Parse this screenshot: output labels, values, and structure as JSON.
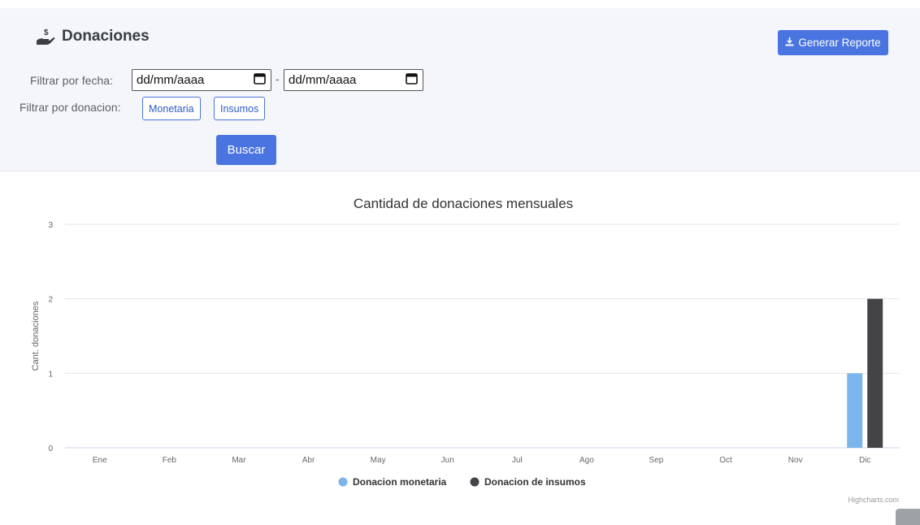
{
  "header": {
    "title": "Donaciones",
    "report_button": "Generar Reporte",
    "brand_color": "#4a74e0"
  },
  "filters": {
    "date_label": "Filtrar por fecha:",
    "date_from": {
      "value": "dd/mm/aaaa"
    },
    "separator": "-",
    "date_to": {
      "value": "dd/mm/aaaa"
    },
    "type_label": "Filtrar por donacion:",
    "type_buttons": [
      "Monetaria",
      "Insumos"
    ],
    "search_button": "Buscar"
  },
  "chart_data": {
    "type": "bar",
    "title": "Cantidad de donaciones mensuales",
    "xlabel": "",
    "ylabel": "Cant. donaciones",
    "categories": [
      "Ene",
      "Feb",
      "Mar",
      "Abr",
      "May",
      "Jun",
      "Jul",
      "Ago",
      "Sep",
      "Oct",
      "Nov",
      "Dic"
    ],
    "series": [
      {
        "name": "Donacion monetaria",
        "color": "#7cb5ec",
        "values": [
          0,
          0,
          0,
          0,
          0,
          0,
          0,
          0,
          0,
          0,
          0,
          1
        ]
      },
      {
        "name": "Donacion de insumos",
        "color": "#434348",
        "values": [
          0,
          0,
          0,
          0,
          0,
          0,
          0,
          0,
          0,
          0,
          0,
          2
        ]
      }
    ],
    "ylim": [
      0,
      3
    ],
    "yticks": [
      0,
      1,
      2,
      3
    ],
    "grid": true,
    "legend_position": "bottom-center",
    "credit": "Highcharts.com"
  }
}
